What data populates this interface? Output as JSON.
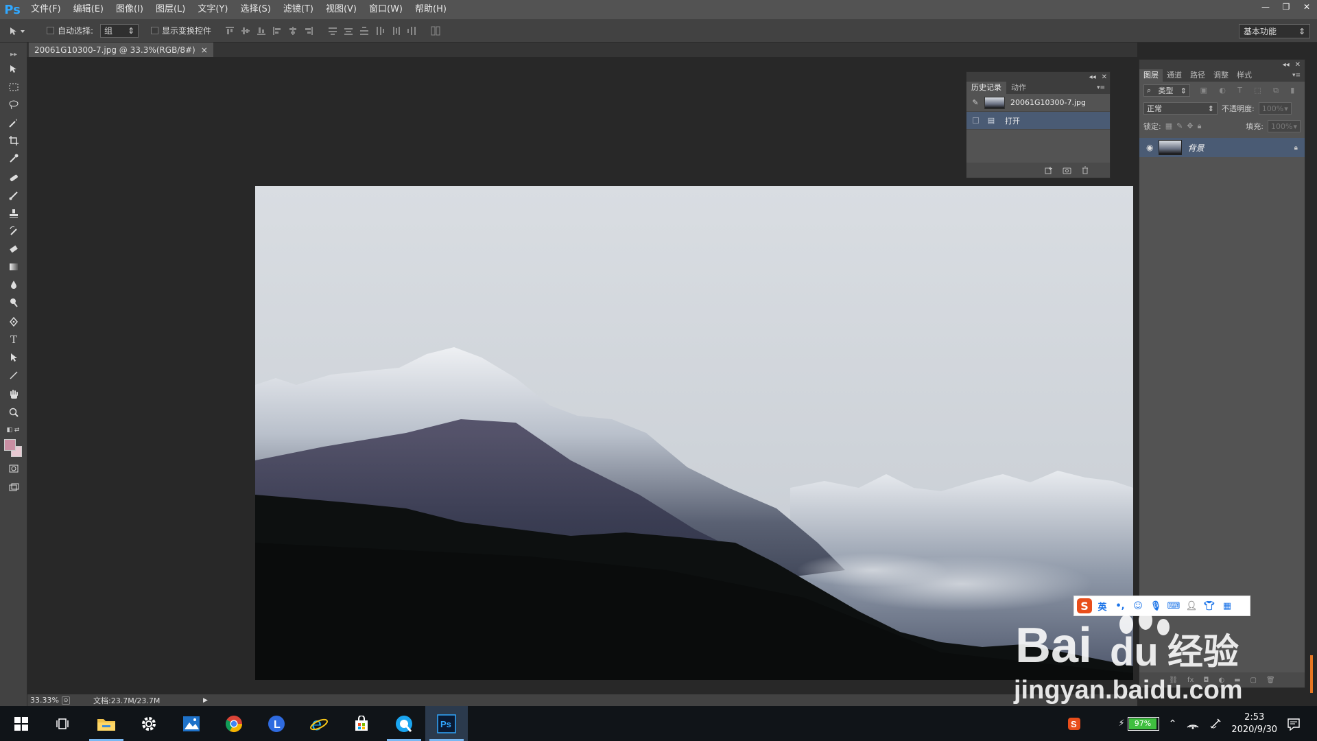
{
  "app": {
    "logo": "Ps"
  },
  "menu": [
    "文件(F)",
    "编辑(E)",
    "图像(I)",
    "图层(L)",
    "文字(Y)",
    "选择(S)",
    "滤镜(T)",
    "视图(V)",
    "窗口(W)",
    "帮助(H)"
  ],
  "window_controls": {
    "minimize": "—",
    "restore": "❐",
    "close": "✕"
  },
  "options": {
    "tool_icon": "move-icon",
    "auto_select_label": "自动选择:",
    "auto_select_value": "组",
    "transform_label": "显示变换控件",
    "workspace": "基本功能"
  },
  "document": {
    "tab_title": "20061G10300-7.jpg @ 33.3%(RGB/8#)",
    "close": "×"
  },
  "history": {
    "tabs": [
      "历史记录",
      "动作"
    ],
    "snapshot": "20061G10300-7.jpg",
    "items": [
      "打开"
    ]
  },
  "layers": {
    "tabs": [
      "图层",
      "通道",
      "路径",
      "调整",
      "样式"
    ],
    "filter": "类型",
    "blend_mode": "正常",
    "opacity_label": "不透明度:",
    "opacity_value": "100%",
    "lock_label": "锁定:",
    "fill_label": "填充:",
    "fill_value": "100%",
    "layer_name": "背景"
  },
  "status": {
    "zoom": "33.33%",
    "doc": "文档:23.7M/23.7M"
  },
  "ime": {
    "mode": "英"
  },
  "watermark": {
    "brand": "Bai",
    "brand2": "du",
    "cn": "经验",
    "url": "jingyan.baidu.com"
  },
  "taskbar": {
    "battery": "97%",
    "time": "2:53",
    "date": "2020/9/30"
  },
  "colors": {
    "foreground": "#c98ea2",
    "background": "#e8c9d2",
    "selection": "#4a5b74",
    "ps_blue": "#31a8ff"
  }
}
